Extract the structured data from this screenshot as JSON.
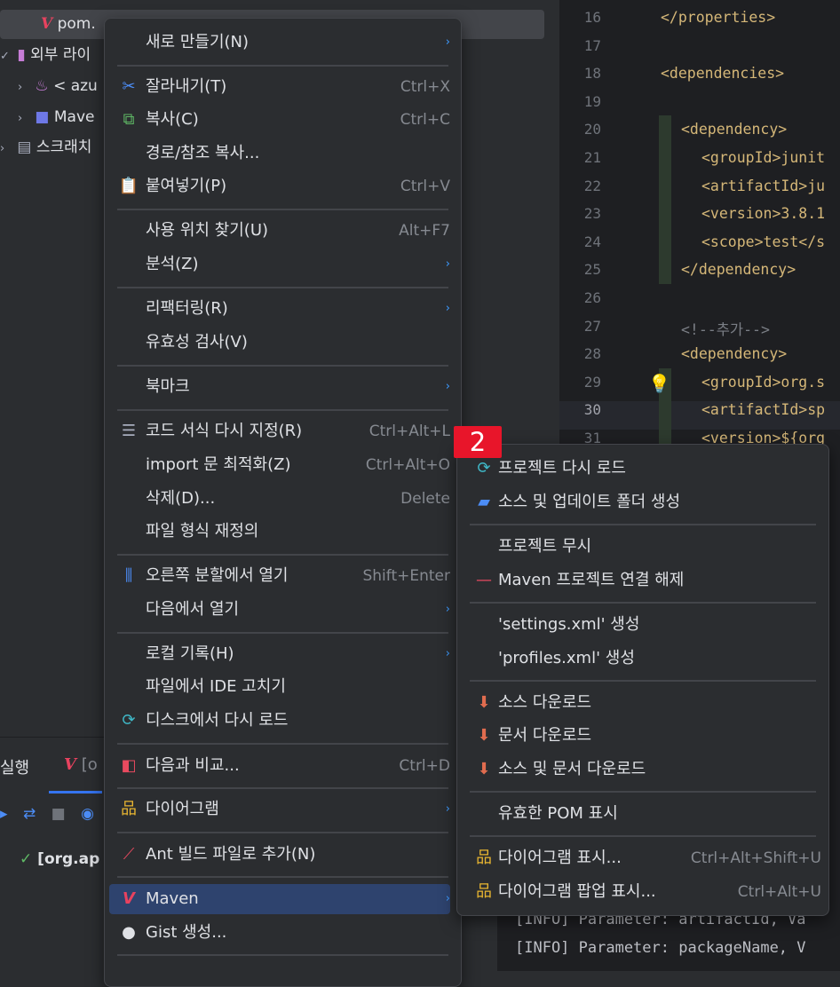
{
  "tree": {
    "items": [
      {
        "label": "pom.",
        "icon": "maven-file-icon"
      },
      {
        "label": "외부 라이",
        "icon": "library-icon"
      },
      {
        "label": "< azu",
        "icon": "java-icon"
      },
      {
        "label": "Mave",
        "icon": "folder-icon"
      },
      {
        "label": "스크래치",
        "icon": "scratch-icon"
      }
    ]
  },
  "editor": {
    "lines": [
      {
        "n": "16",
        "code": "</properties>"
      },
      {
        "n": "17",
        "code": ""
      },
      {
        "n": "18",
        "code": "<dependencies>"
      },
      {
        "n": "19",
        "code": ""
      },
      {
        "n": "20",
        "code": "<dependency>"
      },
      {
        "n": "21",
        "code": "<groupId>junit"
      },
      {
        "n": "22",
        "code": "<artifactId>ju"
      },
      {
        "n": "23",
        "code": "<version>3.8.1"
      },
      {
        "n": "24",
        "code": "<scope>test</s"
      },
      {
        "n": "25",
        "code": "</dependency>"
      },
      {
        "n": "26",
        "code": ""
      },
      {
        "n": "27",
        "code": "<!--추가-->"
      },
      {
        "n": "28",
        "code": "<dependency>"
      },
      {
        "n": "29",
        "code": "<groupId>org.s"
      },
      {
        "n": "30",
        "code": "<artifactId>sp"
      },
      {
        "n": "31",
        "code": "<version>${org"
      }
    ]
  },
  "run_panel": {
    "tab_label": "실행",
    "tab2_label": "[o",
    "run_item": "[org.ap"
  },
  "console": {
    "lines": [
      "[INFO] Parameter: artifactId, Va",
      "[INFO] Parameter: packageName, V"
    ]
  },
  "main_menu": {
    "items": [
      {
        "label": "새로 만들기(N)",
        "shortcut": "",
        "submenu": true,
        "icon": ""
      },
      {
        "label": "잘라내기(T)",
        "shortcut": "Ctrl+X",
        "submenu": false,
        "icon": "scissors-icon"
      },
      {
        "label": "복사(C)",
        "shortcut": "Ctrl+C",
        "submenu": false,
        "icon": "copy-icon"
      },
      {
        "label": "경로/참조 복사...",
        "shortcut": "",
        "submenu": false,
        "icon": ""
      },
      {
        "label": "붙여넣기(P)",
        "shortcut": "Ctrl+V",
        "submenu": false,
        "icon": "clipboard-icon"
      },
      {
        "label": "사용 위치 찾기(U)",
        "shortcut": "Alt+F7",
        "submenu": false,
        "icon": ""
      },
      {
        "label": "분석(Z)",
        "shortcut": "",
        "submenu": true,
        "icon": ""
      },
      {
        "label": "리팩터링(R)",
        "shortcut": "",
        "submenu": true,
        "icon": ""
      },
      {
        "label": "유효성 검사(V)",
        "shortcut": "",
        "submenu": false,
        "icon": ""
      },
      {
        "label": "북마크",
        "shortcut": "",
        "submenu": true,
        "icon": ""
      },
      {
        "label": "코드 서식 다시 지정(R)",
        "shortcut": "Ctrl+Alt+L",
        "submenu": false,
        "icon": "reformat-icon"
      },
      {
        "label": "import 문 최적화(Z)",
        "shortcut": "Ctrl+Alt+O",
        "submenu": false,
        "icon": ""
      },
      {
        "label": "삭제(D)...",
        "shortcut": "Delete",
        "submenu": false,
        "icon": ""
      },
      {
        "label": "파일 형식 재정의",
        "shortcut": "",
        "submenu": false,
        "icon": ""
      },
      {
        "label": "오른쪽 분할에서 열기",
        "shortcut": "Shift+Enter",
        "submenu": false,
        "icon": "split-icon"
      },
      {
        "label": "다음에서 열기",
        "shortcut": "",
        "submenu": true,
        "icon": ""
      },
      {
        "label": "로컬 기록(H)",
        "shortcut": "",
        "submenu": true,
        "icon": ""
      },
      {
        "label": "파일에서 IDE 고치기",
        "shortcut": "",
        "submenu": false,
        "icon": ""
      },
      {
        "label": "디스크에서 다시 로드",
        "shortcut": "",
        "submenu": false,
        "icon": "reload-icon"
      },
      {
        "label": "다음과 비교...",
        "shortcut": "Ctrl+D",
        "submenu": false,
        "icon": "compare-icon"
      },
      {
        "label": "다이어그램",
        "shortcut": "",
        "submenu": true,
        "icon": "diagram-icon"
      },
      {
        "label": "Ant 빌드 파일로 추가(N)",
        "shortcut": "",
        "submenu": false,
        "icon": "ant-icon"
      },
      {
        "label": "Maven",
        "shortcut": "",
        "submenu": true,
        "icon": "maven-icon"
      },
      {
        "label": "Gist 생성...",
        "shortcut": "",
        "submenu": false,
        "icon": "github-icon"
      }
    ]
  },
  "badge": "2",
  "maven_submenu": {
    "items": [
      {
        "label": "프로젝트 다시 로드",
        "shortcut": "",
        "icon": "reload-icon"
      },
      {
        "label": "소스 및 업데이트 폴더 생성",
        "shortcut": "",
        "icon": "folder-refresh-icon"
      },
      {
        "label": "프로젝트 무시",
        "shortcut": "",
        "icon": ""
      },
      {
        "label": "Maven 프로젝트 연결 해제",
        "shortcut": "",
        "icon": "minus-icon"
      },
      {
        "label": "'settings.xml' 생성",
        "shortcut": "",
        "icon": ""
      },
      {
        "label": "'profiles.xml' 생성",
        "shortcut": "",
        "icon": ""
      },
      {
        "label": "소스 다운로드",
        "shortcut": "",
        "icon": "download-icon"
      },
      {
        "label": "문서 다운로드",
        "shortcut": "",
        "icon": "download-icon"
      },
      {
        "label": "소스 및 문서 다운로드",
        "shortcut": "",
        "icon": "download-icon"
      },
      {
        "label": "유효한 POM 표시",
        "shortcut": "",
        "icon": ""
      },
      {
        "label": "다이어그램 표시...",
        "shortcut": "Ctrl+Alt+Shift+U",
        "icon": "diagram-icon"
      },
      {
        "label": "다이어그램 팝업 표시...",
        "shortcut": "Ctrl+Alt+U",
        "icon": "diagram-icon"
      }
    ]
  }
}
